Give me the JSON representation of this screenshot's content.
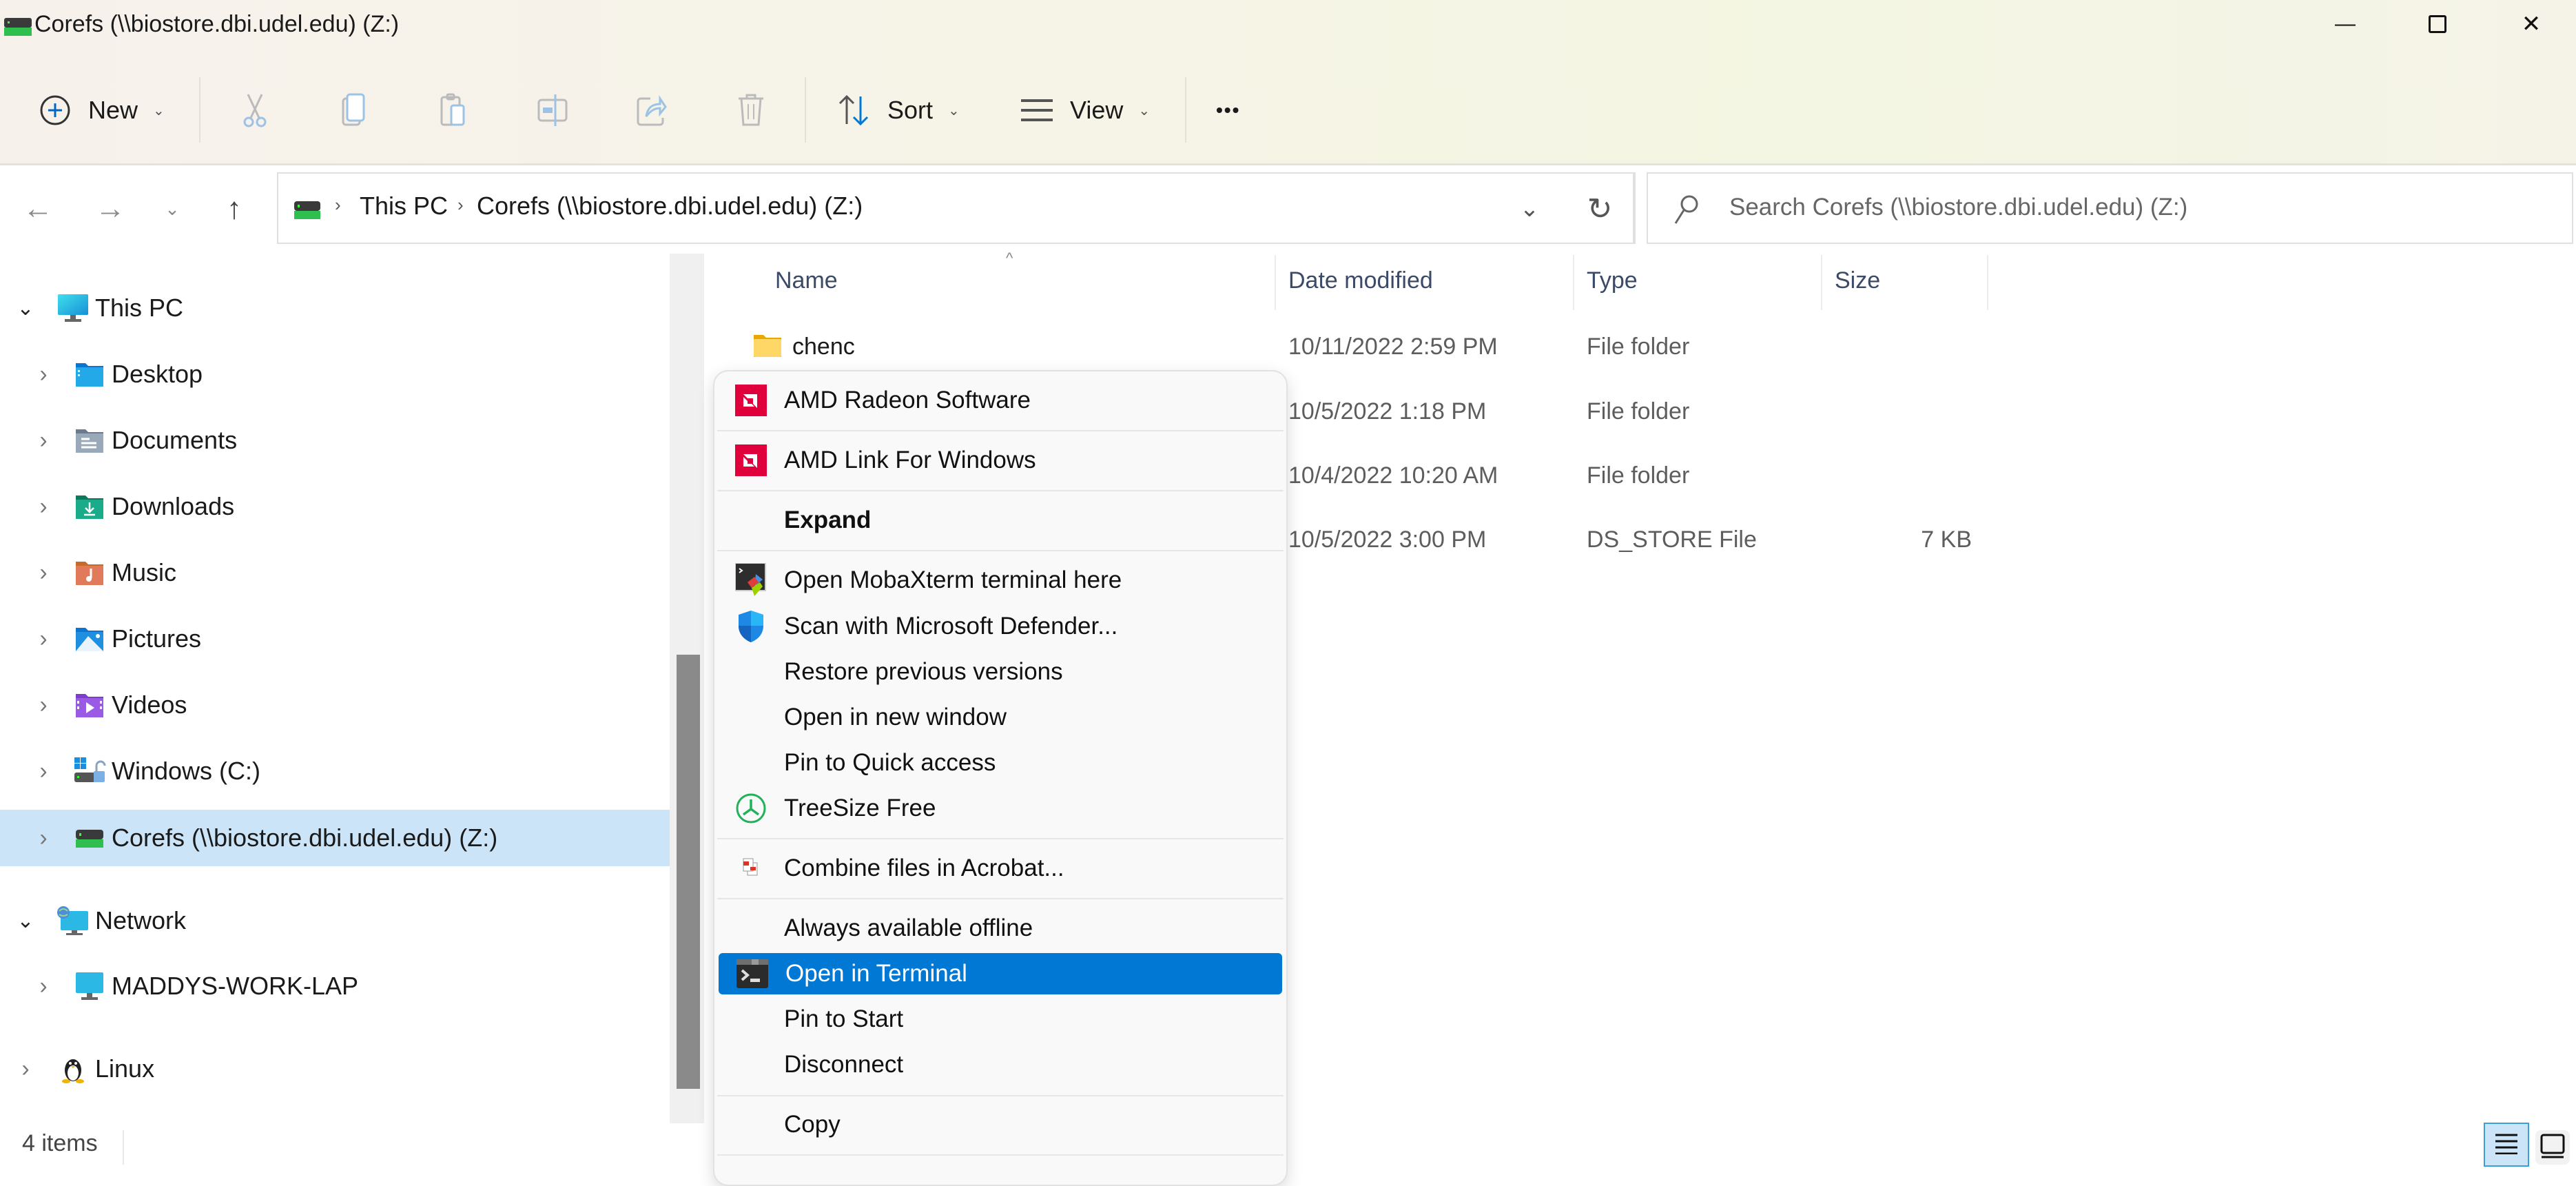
{
  "window": {
    "title": "Corefs (\\\\biostore.dbi.udel.edu) (Z:)",
    "minimize_glyph": "—",
    "maximize_glyph": "☐",
    "close_glyph": "✕"
  },
  "toolbar": {
    "new_label": "New",
    "sort_label": "Sort",
    "view_label": "View",
    "more_glyph": "•••",
    "caret": "⌄",
    "icons": [
      "plus-circle-icon",
      "cut-icon",
      "copy-icon",
      "paste-icon",
      "rename-icon",
      "share-icon",
      "delete-icon",
      "sort-icon",
      "view-list-icon",
      "more-icon"
    ]
  },
  "nav": {
    "back_glyph": "←",
    "forward_glyph": "→",
    "recent_glyph": "⌄",
    "up_glyph": "↑",
    "breadcrumb": [
      "This PC",
      "Corefs (\\\\biostore.dbi.udel.edu) (Z:)"
    ],
    "crumb_sep": "›",
    "dropdown_glyph": "⌄",
    "refresh_glyph": "↻",
    "search_placeholder": "Search Corefs (\\\\biostore.dbi.udel.edu) (Z:)",
    "search_glyph": "⚲"
  },
  "sidebar": {
    "items": [
      {
        "label": "This PC",
        "expanded": true,
        "chevron": "⌄",
        "icon": "monitor-icon"
      },
      {
        "label": "Desktop",
        "chevron": "›",
        "icon": "desktop-folder-icon"
      },
      {
        "label": "Documents",
        "chevron": "›",
        "icon": "documents-folder-icon"
      },
      {
        "label": "Downloads",
        "chevron": "›",
        "icon": "downloads-folder-icon"
      },
      {
        "label": "Music",
        "chevron": "›",
        "icon": "music-folder-icon"
      },
      {
        "label": "Pictures",
        "chevron": "›",
        "icon": "pictures-folder-icon"
      },
      {
        "label": "Videos",
        "chevron": "›",
        "icon": "videos-folder-icon"
      },
      {
        "label": "Windows (C:)",
        "chevron": "›",
        "icon": "windows-drive-icon"
      },
      {
        "label": "Corefs (\\\\biostore.dbi.udel.edu) (Z:)",
        "chevron": "›",
        "icon": "network-drive-icon",
        "selected": true
      },
      {
        "label": "Network",
        "expanded": true,
        "chevron": "⌄",
        "icon": "network-icon"
      },
      {
        "label": "MADDYS-WORK-LAP",
        "chevron": "›",
        "icon": "computer-icon"
      },
      {
        "label": "Linux",
        "chevron": "›",
        "icon": "linux-penguin-icon"
      }
    ]
  },
  "filelist": {
    "columns": [
      "Name",
      "Date modified",
      "Type",
      "Size"
    ],
    "sort_glyph": "^",
    "rows": [
      {
        "name": "chenc",
        "date": "10/11/2022 2:59 PM",
        "type": "File folder",
        "size": ""
      },
      {
        "name": "",
        "date": "10/5/2022 1:18 PM",
        "type": "File folder",
        "size": ""
      },
      {
        "name": "",
        "date": "10/4/2022 10:20 AM",
        "type": "File folder",
        "size": ""
      },
      {
        "name": "",
        "date": "10/5/2022 3:00 PM",
        "type": "DS_STORE File",
        "size": "7 KB"
      }
    ]
  },
  "context_menu": {
    "items": [
      {
        "label": "AMD Radeon Software",
        "icon": "amd-icon"
      },
      {
        "label": "AMD Link For Windows",
        "icon": "amd-icon"
      },
      {
        "label": "Expand",
        "bold": true
      },
      {
        "label": "Open MobaXterm terminal here",
        "icon": "mobaxterm-icon"
      },
      {
        "label": "Scan with Microsoft Defender...",
        "icon": "defender-shield-icon"
      },
      {
        "label": "Restore previous versions"
      },
      {
        "label": "Open in new window"
      },
      {
        "label": "Pin to Quick access"
      },
      {
        "label": "TreeSize Free",
        "icon": "treesize-icon"
      },
      {
        "label": "Combine files in Acrobat...",
        "icon": "acrobat-combine-icon"
      },
      {
        "label": "Always available offline"
      },
      {
        "label": "Open in Terminal",
        "icon": "terminal-icon",
        "highlighted": true
      },
      {
        "label": "Pin to Start"
      },
      {
        "label": "Disconnect"
      },
      {
        "label": "Copy"
      }
    ]
  },
  "status": {
    "item_count": "4 items"
  },
  "colors": {
    "accent": "#0078d4",
    "selection": "#cce4f7",
    "amd_red": "#e0003c"
  }
}
